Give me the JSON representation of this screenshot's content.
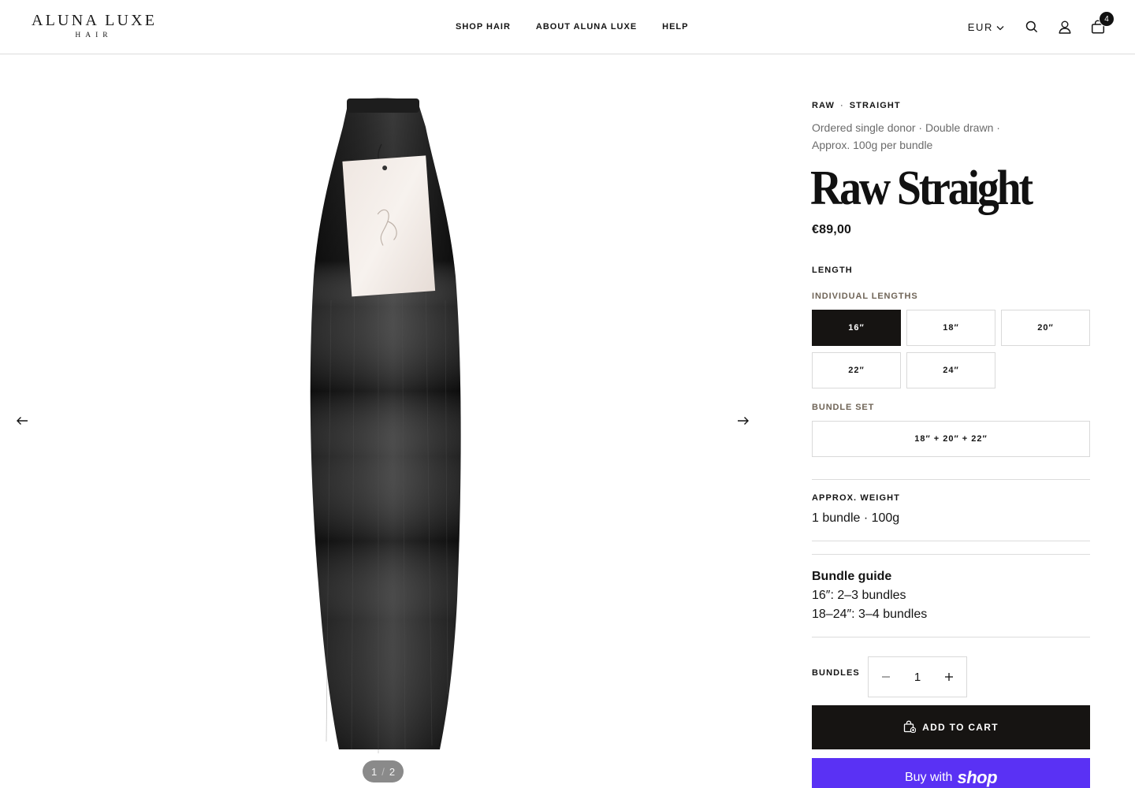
{
  "header": {
    "logo_main": "ALUNA LUXE",
    "logo_sub": "HAIR",
    "nav": [
      "SHOP HAIR",
      "ABOUT ALUNA LUXE",
      "HELP"
    ],
    "currency": "EUR",
    "cart_count": "4"
  },
  "gallery": {
    "pager_current": "1",
    "pager_separator": "/",
    "pager_total": "2"
  },
  "product": {
    "eyebrow_1": "RAW",
    "eyebrow_sep": "·",
    "eyebrow_2": "STRAIGHT",
    "features_line1": "Ordered single donor · Double drawn ·",
    "features_line2": "Approx. 100g per bundle",
    "title": "Raw Straight",
    "price": "€89,00",
    "option_title": "LENGTH",
    "individual_label": "INDIVIDUAL LENGTHS",
    "lengths": [
      "16″",
      "18″",
      "20″",
      "22″",
      "24″"
    ],
    "selected_length": "16″",
    "bundle_set_label": "BUNDLE SET",
    "bundle_set": "18″ + 20″ + 22″",
    "weight_title": "APPROX. WEIGHT",
    "weight_value": "1 bundle · 100g",
    "guide_title": "Bundle guide",
    "guide_line1": "16″: 2–3 bundles",
    "guide_line2": "18–24″: 3–4 bundles",
    "quantity_label": "BUNDLES",
    "quantity": "1",
    "add_to_cart": "ADD TO CART",
    "buy_with": "Buy with",
    "shop_word": "shop"
  },
  "colors": {
    "primary_dark": "#161412",
    "shop_pay": "#5a31f4",
    "muted_label": "#6f6457"
  },
  "icons": [
    "chevron-down-icon",
    "search-icon",
    "account-icon",
    "cart-icon",
    "arrow-left-icon",
    "arrow-right-icon",
    "minus-icon",
    "plus-icon",
    "bag-plus-icon"
  ]
}
